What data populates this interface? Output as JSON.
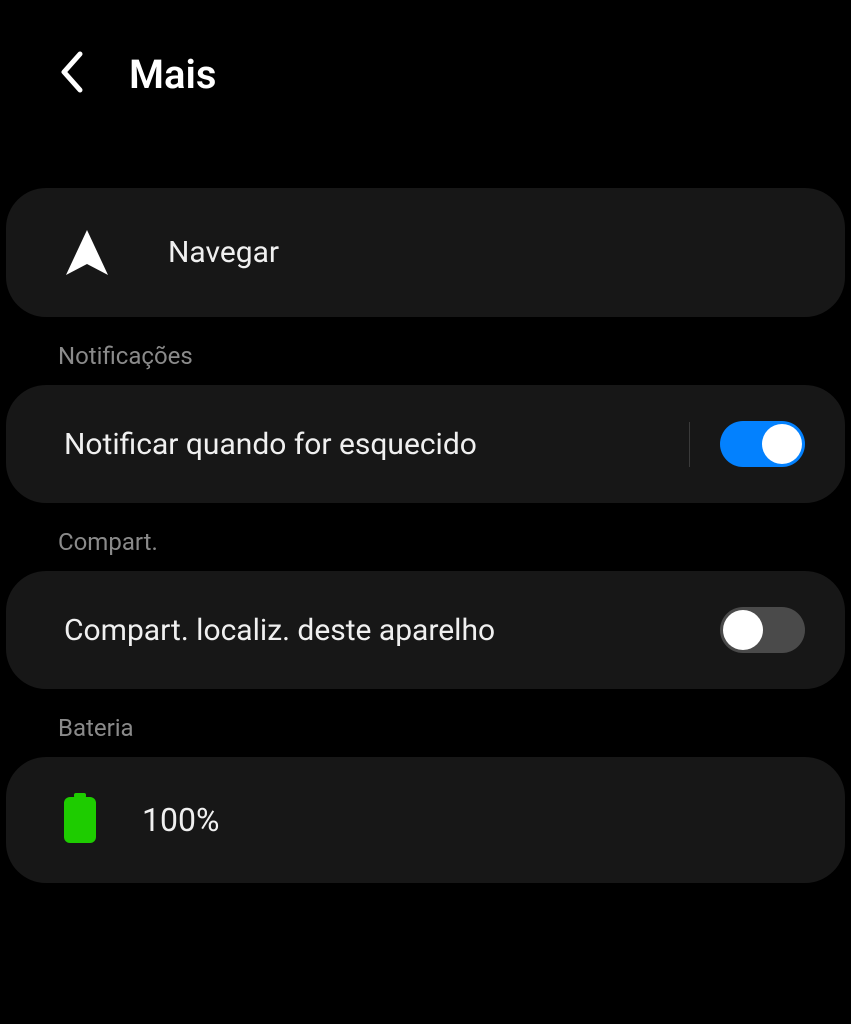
{
  "header": {
    "title": "Mais"
  },
  "navigate": {
    "label": "Navegar"
  },
  "notifications": {
    "section_label": "Notificações",
    "notify_when_forgotten_label": "Notificar quando for esquecido",
    "notify_when_forgotten_enabled": true
  },
  "sharing": {
    "section_label": "Compart.",
    "share_location_label": "Compart. localiz. deste aparelho",
    "share_location_enabled": false
  },
  "battery": {
    "section_label": "Bateria",
    "level": "100%",
    "color": "#1ecc00"
  }
}
